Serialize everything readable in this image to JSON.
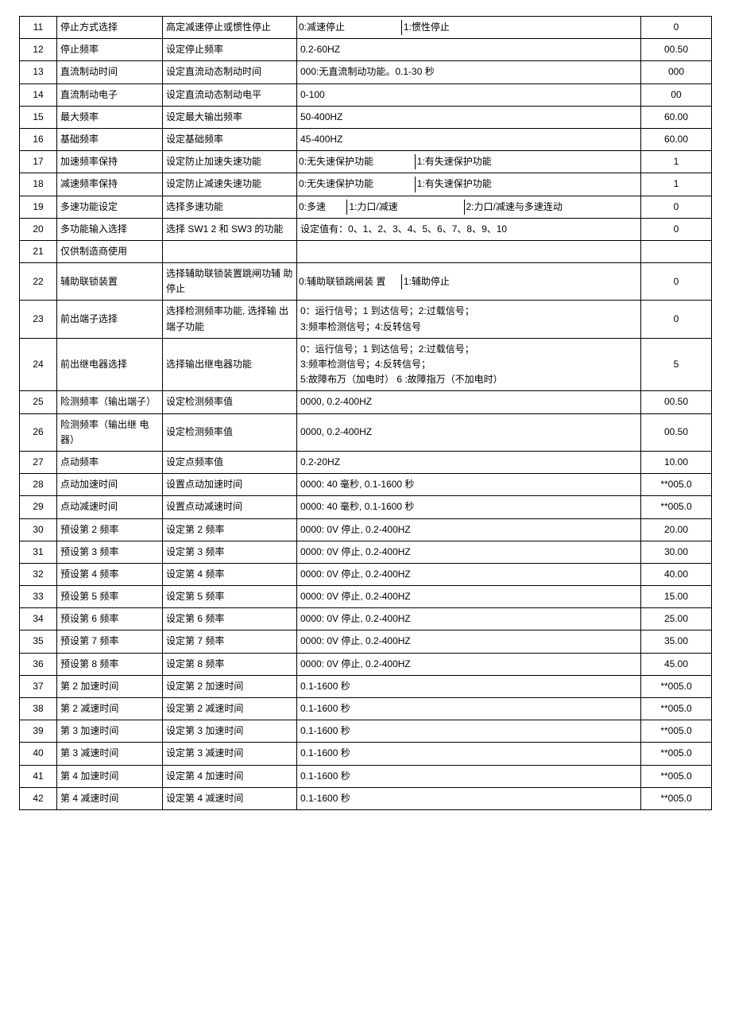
{
  "rows": [
    {
      "num": "11",
      "name": "停止方式选择",
      "desc": "高定减速停止或惯性停止",
      "range_cells": [
        "0:减速停止",
        "1:惯性停止"
      ],
      "range_widths": [
        "30%",
        "70%"
      ],
      "value": "0"
    },
    {
      "num": "12",
      "name": "停止频率",
      "desc": "设定停止频率",
      "range": "0.2-60HZ",
      "value": "00.50"
    },
    {
      "num": "13",
      "name": "直流制动时间",
      "desc": "设定直流动态制动时间",
      "range": "000:无直流制动功能。0.1-30 秒",
      "value": "000"
    },
    {
      "num": "14",
      "name": "直流制动电子",
      "desc": "设定直流动态制动电平",
      "range": "0-100",
      "value": "00"
    },
    {
      "num": "15",
      "name": "最大频率",
      "desc": "设定最大输出频率",
      "range": "50-400HZ",
      "value": "60.00"
    },
    {
      "num": "16",
      "name": "基础频率",
      "desc": "设定基础频率",
      "range": "45-400HZ",
      "value": "60.00"
    },
    {
      "num": "17",
      "name": "加速频率保持",
      "desc": "设定防止加速失速功能",
      "range_cells": [
        "0:无失速保护功能",
        "1:有失速保护功能"
      ],
      "range_widths": [
        "34%",
        "66%"
      ],
      "value": "1"
    },
    {
      "num": "18",
      "name": "减速频率保持",
      "desc": "设定防止减速失速功能",
      "range_cells": [
        "0:无失速保护功能",
        "1:有失速保护功能"
      ],
      "range_widths": [
        "34%",
        "66%"
      ],
      "value": "1"
    },
    {
      "num": "19",
      "name": "多速功能设定",
      "desc": "选择多速功能",
      "range_cells": [
        "0:多速",
        "1:力口/减速",
        "2:力口/减速与多速连动"
      ],
      "range_widths": [
        "14%",
        "34%",
        "52%"
      ],
      "value": "0"
    },
    {
      "num": "20",
      "name": "多功能输入选择",
      "desc": "选择 SW1 2 和 SW3 的功能",
      "range": "设定值有：0、1、2、3、4、5、6、7、8、9、10",
      "value": "0"
    },
    {
      "num": "21",
      "name": "仅供制造商使用",
      "desc": "",
      "range": "",
      "value": ""
    },
    {
      "num": "22",
      "name": "辅助联锁装置",
      "desc": "选择辅助联锁装置跳闸功辅  助停止",
      "range_cells": [
        "0:辅助联锁跳闸装  置",
        "1:辅助停止"
      ],
      "range_widths": [
        "30%",
        "70%"
      ],
      "value": "0"
    },
    {
      "num": "23",
      "name": "前出端子选择",
      "desc": "选择检测频率功能, 选择输  出端子功能",
      "range": "0：运行信号；1 到达信号；2:过载信号；\n3:频率检测信号；4:反转信号",
      "value": "0"
    },
    {
      "num": "24",
      "name": "前出继电器选择",
      "desc": "选择输出继电器功能",
      "range": "0：运行信号；1 到达信号；2:过载信号；\n3:频率检测信号；4:反转信号；\n5:故障布万（加电时）  6 :故障指万（不加电时）",
      "value": "5"
    },
    {
      "num": "25",
      "name": "险测频率（输出端子）",
      "desc": "设定检测频率值",
      "range": "0000, 0.2-400HZ",
      "value": "00.50"
    },
    {
      "num": "26",
      "name": "险测频率（输出继  电器）",
      "desc": "设定检测频率值",
      "range": "0000, 0.2-400HZ",
      "value": "00.50"
    },
    {
      "num": "27",
      "name": "点动频率",
      "desc": "设定点频率值",
      "range": "0.2-20HZ",
      "value": "10.00"
    },
    {
      "num": "28",
      "name": "点动加速时间",
      "desc": "设置点动加速时间",
      "range": "0000: 40 毫秒, 0.1-1600 秒",
      "value": "**005.0"
    },
    {
      "num": "29",
      "name": "点动减速时间",
      "desc": "设置点动减速时间",
      "range": "0000: 40 毫秒, 0.1-1600 秒",
      "value": "**005.0"
    },
    {
      "num": "30",
      "name": "预设第 2 频率",
      "desc": "设定第 2 频率",
      "range": "0000: 0V 停止,  0.2-400HZ",
      "value": "20.00"
    },
    {
      "num": "31",
      "name": "预设第 3 频率",
      "desc": "设定第 3 频率",
      "range": "0000: 0V 停止,  0.2-400HZ",
      "value": "30.00"
    },
    {
      "num": "32",
      "name": "预设第 4 频率",
      "desc": "设定第 4 频率",
      "range": "0000: 0V 停止,  0.2-400HZ",
      "value": "40.00"
    },
    {
      "num": "33",
      "name": "预设第 5 频率",
      "desc": "设定第 5 频率",
      "range": "0000: 0V 停止,  0.2-400HZ",
      "value": "15.00"
    },
    {
      "num": "34",
      "name": "预设第 6 频率",
      "desc": "设定第 6 频率",
      "range": "0000: 0V 停止,  0.2-400HZ",
      "value": "25.00"
    },
    {
      "num": "35",
      "name": "预设第 7 频率",
      "desc": "设定第 7 频率",
      "range": "0000: 0V 停止,  0.2-400HZ",
      "value": "35.00"
    },
    {
      "num": "36",
      "name": "预设第 8 频率",
      "desc": "设定第 8 频率",
      "range": "0000: 0V 停止,  0.2-400HZ",
      "value": "45.00"
    },
    {
      "num": "37",
      "name": "第 2 加速时间",
      "desc": "设定第 2 加速时间",
      "range": "0.1-1600 秒",
      "value": "**005.0"
    },
    {
      "num": "38",
      "name": "第 2 减速时间",
      "desc": "设定第 2 减速时间",
      "range": "0.1-1600 秒",
      "value": "**005.0"
    },
    {
      "num": "39",
      "name": "第 3 加速时间",
      "desc": "设定第 3 加速时间",
      "range": "0.1-1600 秒",
      "value": "**005.0"
    },
    {
      "num": "40",
      "name": "第 3 减速时间",
      "desc": "设定第 3 减速时间",
      "range": "0.1-1600 秒",
      "value": "**005.0"
    },
    {
      "num": "41",
      "name": "第 4 加速时间",
      "desc": "设定第 4 加速时间",
      "range": "0.1-1600 秒",
      "value": "**005.0"
    },
    {
      "num": "42",
      "name": "第 4 减速时间",
      "desc": "设定第 4 减速时间",
      "range": "0.1-1600 秒",
      "value": "**005.0"
    }
  ]
}
